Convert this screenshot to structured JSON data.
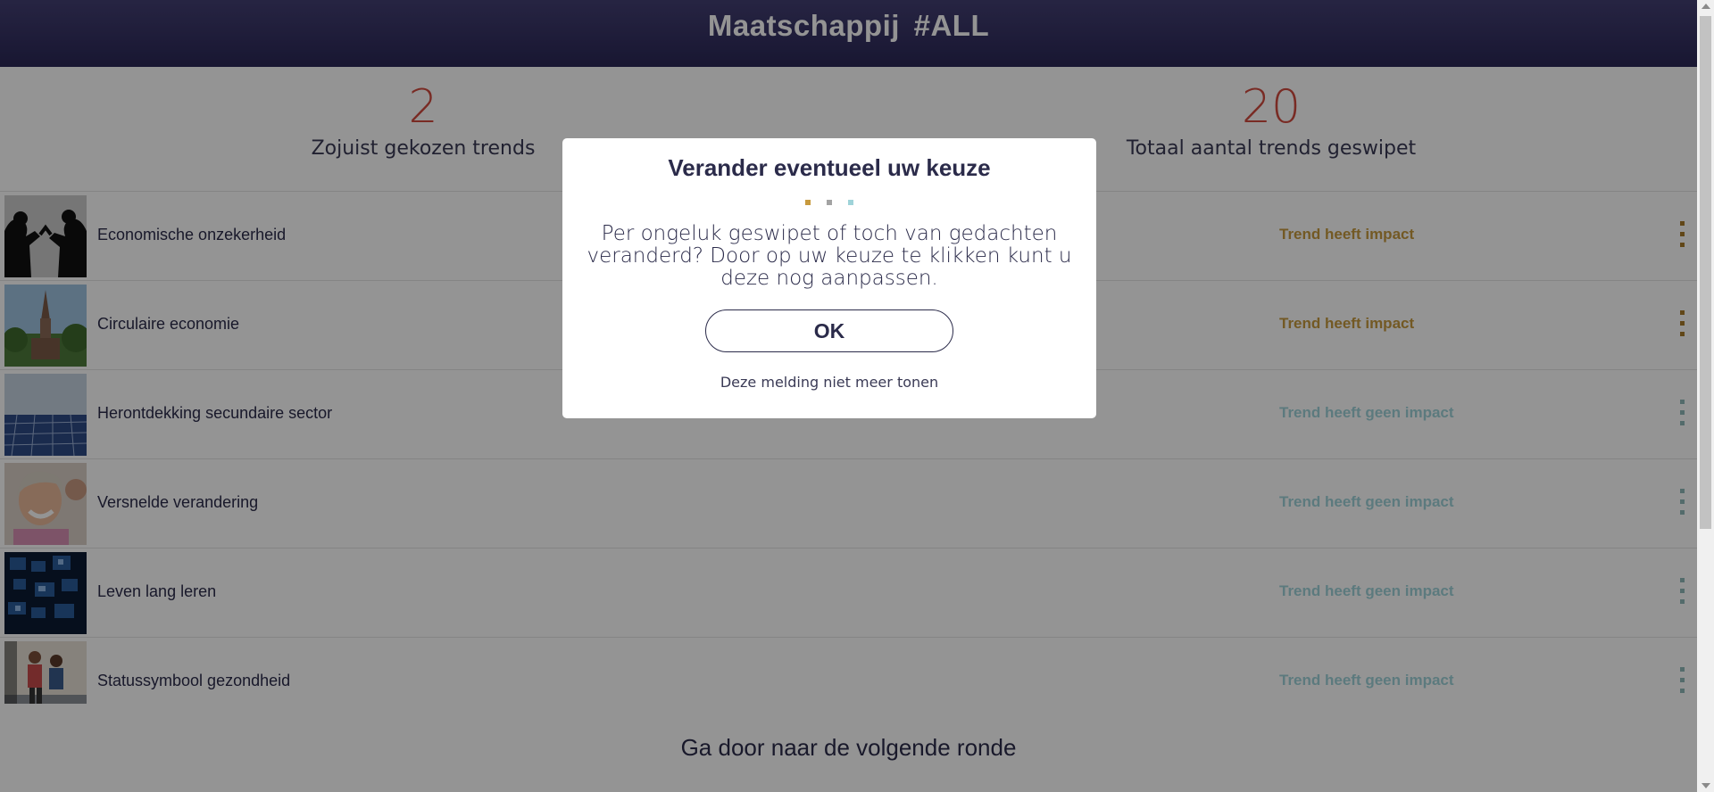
{
  "header": {
    "title": "Maatschappij  #ALL"
  },
  "stats": {
    "chosen": {
      "value": "2",
      "label": "Zojuist gekozen trends"
    },
    "total": {
      "value": "20",
      "label": "Totaal aantal trends geswipet"
    }
  },
  "trends": [
    {
      "name": "Economische onzekerheid",
      "impact": "Trend heeft impact",
      "has_impact": true,
      "image": "silhouettes-arguing"
    },
    {
      "name": "Circulaire economie",
      "impact": "Trend heeft impact",
      "has_impact": true,
      "image": "church-tower"
    },
    {
      "name": "Herontdekking secundaire sector",
      "impact": "Trend heeft geen impact",
      "has_impact": false,
      "image": "solar-panels"
    },
    {
      "name": "Versnelde verandering",
      "impact": "Trend heeft geen impact",
      "has_impact": false,
      "image": "laughing-woman"
    },
    {
      "name": "Leven lang leren",
      "impact": "Trend heeft geen impact",
      "has_impact": false,
      "image": "digital-screens"
    },
    {
      "name": "Statussymbool gezondheid",
      "impact": "Trend heeft geen impact",
      "has_impact": false,
      "image": "runners"
    }
  ],
  "footer": {
    "next_label": "Ga door naar de volgende ronde"
  },
  "modal": {
    "title": "Verander eventueel uw keuze",
    "text": "Per ongeluk geswipet of toch van gedachten veranderd? Door op uw keuze te klikken kunt u deze nog aanpassen.",
    "ok_label": "OK",
    "dont_show_label": "Deze melding niet meer tonen"
  },
  "colors": {
    "header_bg": "#2a2756",
    "number": "#d14a3f",
    "impact": "#c79a3e",
    "no_impact": "#9fd3d9",
    "text": "#2b2b4a",
    "modal_dots": [
      "#c79a3e",
      "#a3a3a3",
      "#9fd3d9"
    ]
  }
}
